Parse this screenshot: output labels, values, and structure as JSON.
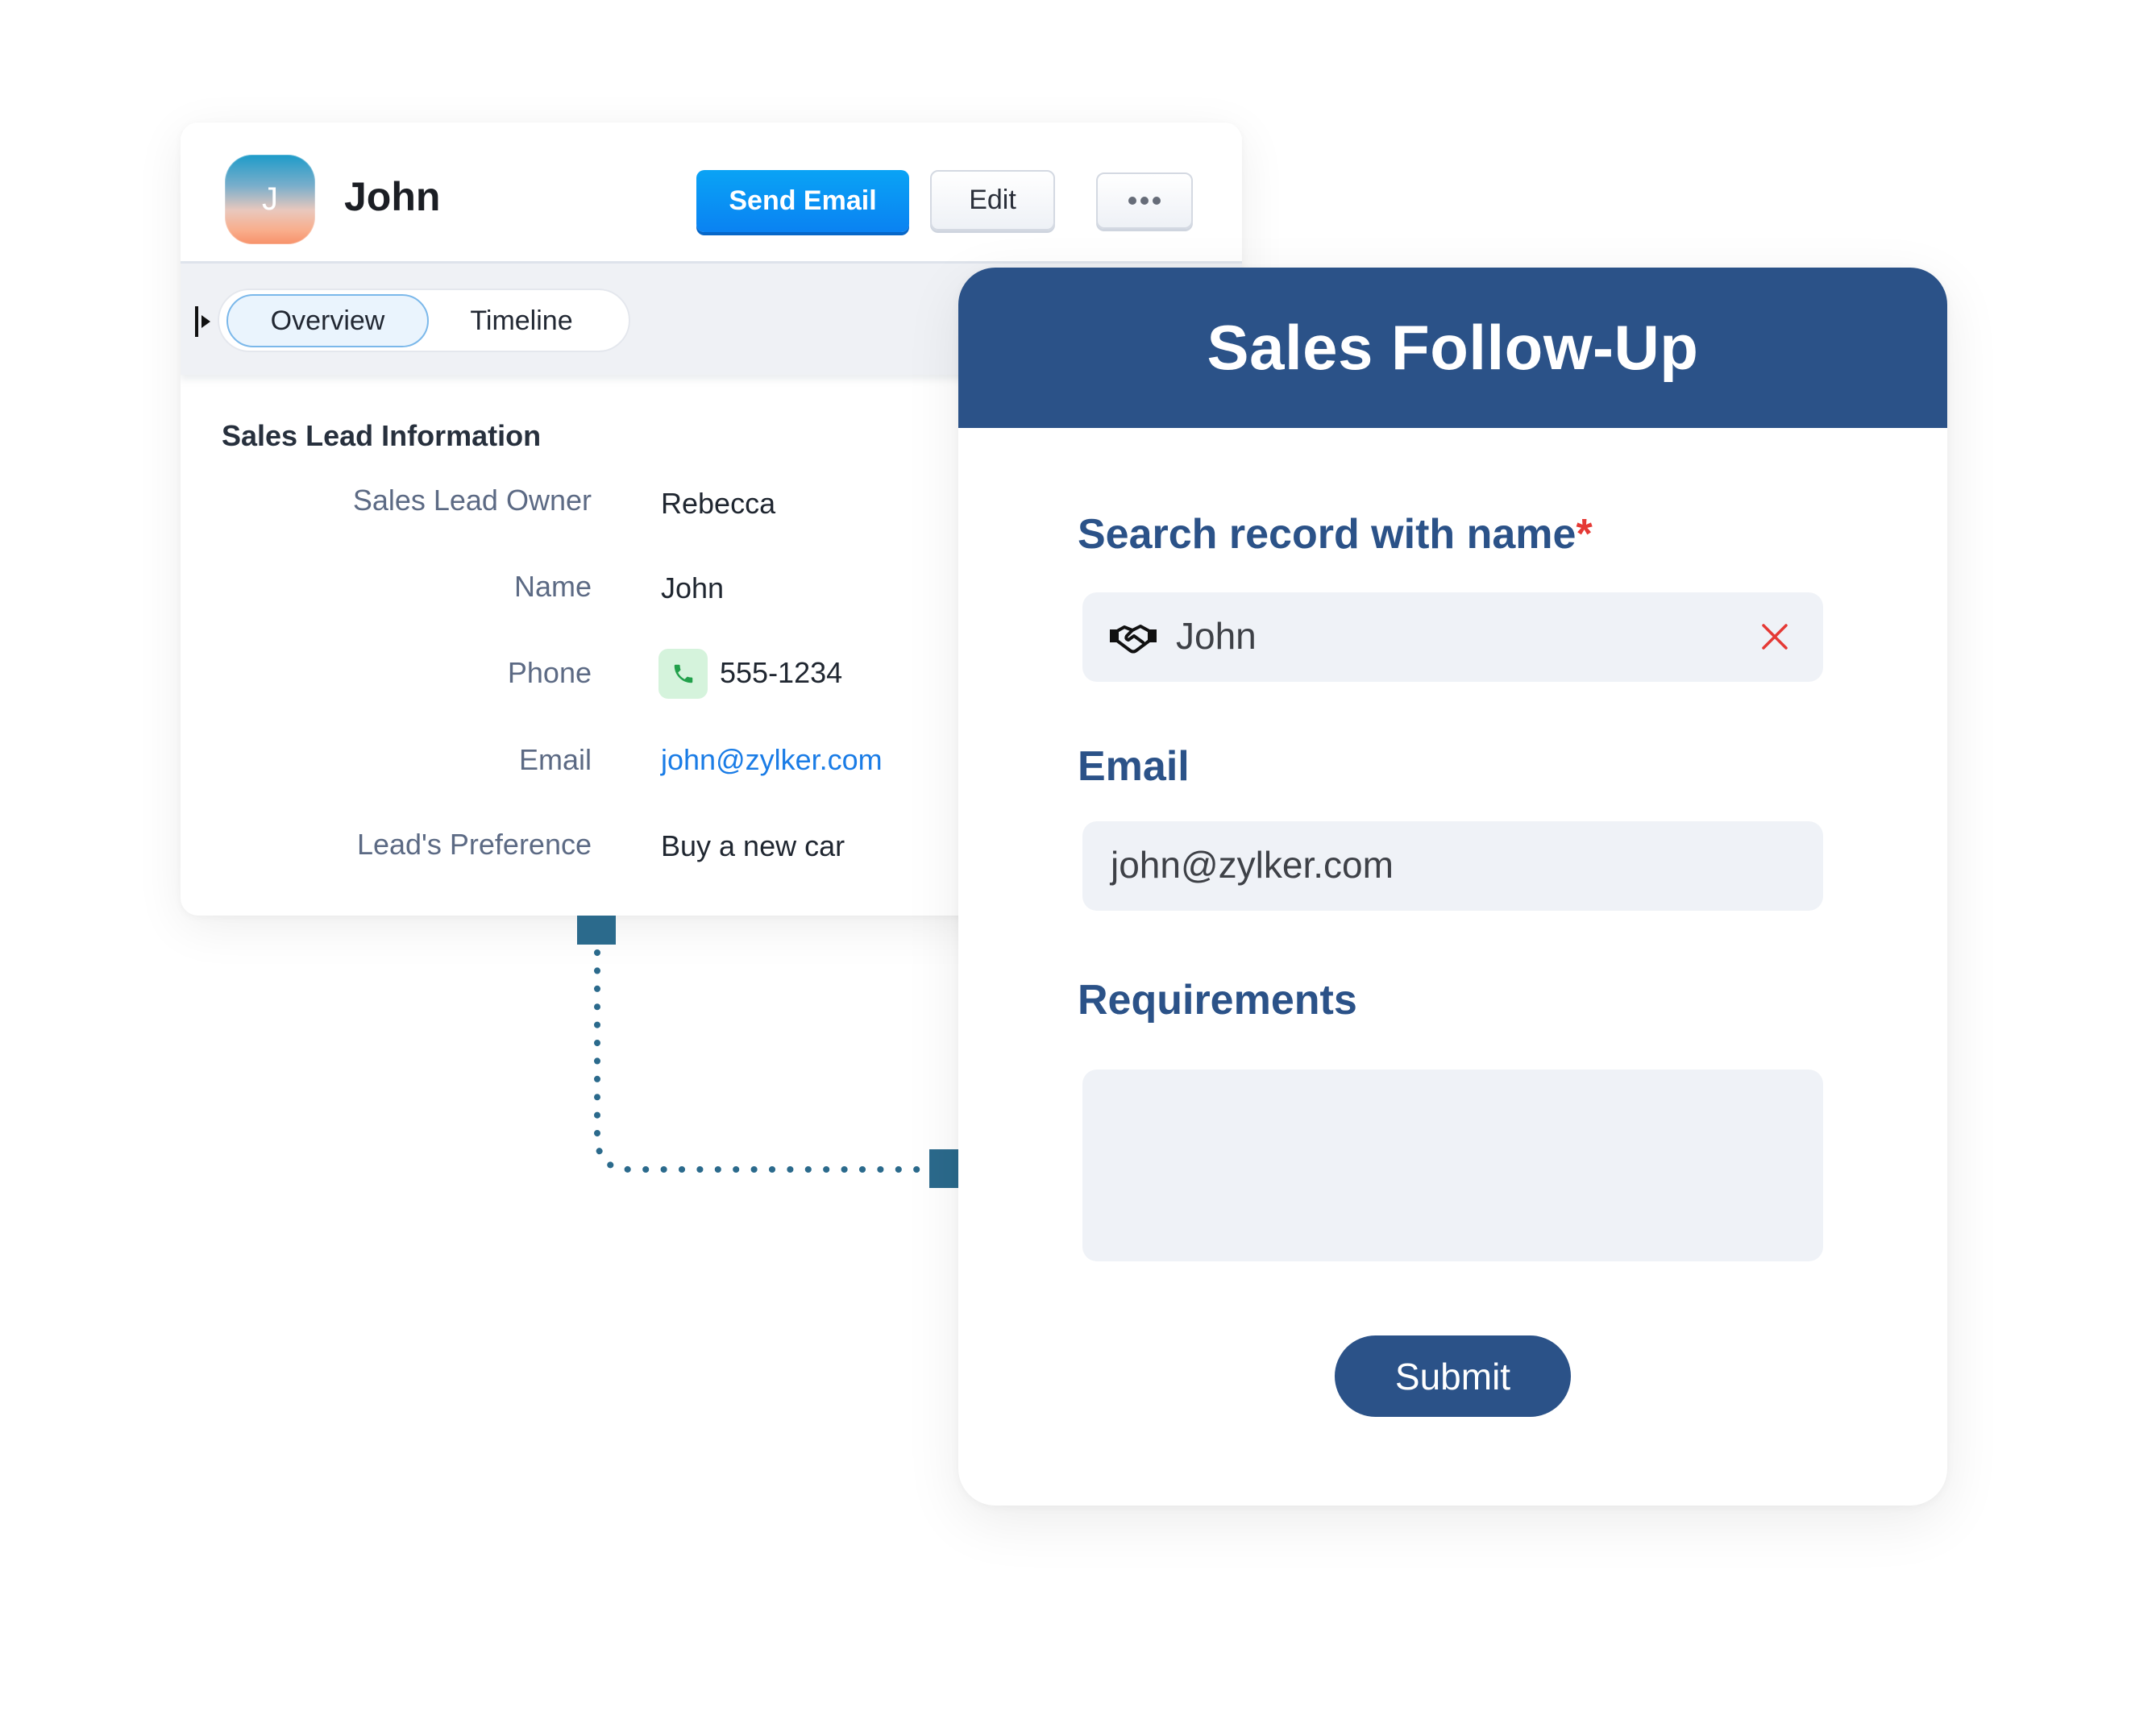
{
  "lead_card": {
    "avatar_initial": "J",
    "name": "John",
    "actions": {
      "send_email_label": "Send Email",
      "edit_label": "Edit",
      "more_icon": "ellipsis-icon"
    },
    "tabs": [
      {
        "label": "Overview",
        "active": true
      },
      {
        "label": "Timeline",
        "active": false
      }
    ],
    "section_title": "Sales Lead Information",
    "fields": [
      {
        "label": "Sales Lead Owner",
        "value": "Rebecca"
      },
      {
        "label": "Name",
        "value": "John"
      },
      {
        "label": "Phone",
        "value": "555-1234",
        "icon": "phone-icon"
      },
      {
        "label": "Email",
        "value": "john@zylker.com",
        "link": true
      },
      {
        "label": "Lead's Preference",
        "value": "Buy a new car"
      }
    ]
  },
  "form": {
    "title": "Sales Follow-Up",
    "search_label": "Search record with name",
    "required_marker": "*",
    "search_value": "John",
    "search_icon": "handshake-icon",
    "email_label": "Email",
    "email_value": "john@zylker.com",
    "requirements_label": "Requirements",
    "requirements_value": "",
    "submit_label": "Submit"
  },
  "colors": {
    "form_primary": "#2b5288",
    "send_button": "#0a8ef3",
    "link": "#1a7ce6",
    "required": "#e53935",
    "connector": "#2b6a8c",
    "phone_badge": "#d5f3dc",
    "phone_icon": "#22a04b"
  }
}
